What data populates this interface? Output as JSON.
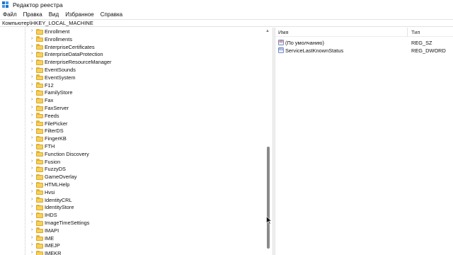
{
  "window": {
    "title": "Редактор реестра",
    "icon": "registry-editor-icon"
  },
  "menu": [
    "Файл",
    "Правка",
    "Вид",
    "Избранное",
    "Справка"
  ],
  "address": "Компьютер\\HKEY_LOCAL_MACHINE",
  "tree": {
    "items": [
      "Enrollment",
      "Enrollments",
      "EnterpriseCertificates",
      "EnterpriseDataProtection",
      "EnterpriseResourceManager",
      "EventSounds",
      "EventSystem",
      "F12",
      "FamilyStore",
      "Fax",
      "FaxServer",
      "Feeds",
      "FilePicker",
      "FilterDS",
      "FingerKB",
      "FTH",
      "Function Discovery",
      "Fusion",
      "FuzzyDS",
      "GameOverlay",
      "HTMLHelp",
      "Hvsi",
      "IdentityCRL",
      "IdentityStore",
      "IHDS",
      "ImageTimeSettings",
      "IMAPI",
      "IME",
      "IMEJP",
      "IMEKR"
    ]
  },
  "values": {
    "headers": {
      "name": "Имя",
      "type": "Тип"
    },
    "rows": [
      {
        "name": "(По умолчанию)",
        "type": "REG_SZ",
        "icon": "string-value-icon"
      },
      {
        "name": "ServiceLastKnownStatus",
        "type": "REG_DWORD",
        "icon": "dword-value-icon"
      }
    ]
  }
}
